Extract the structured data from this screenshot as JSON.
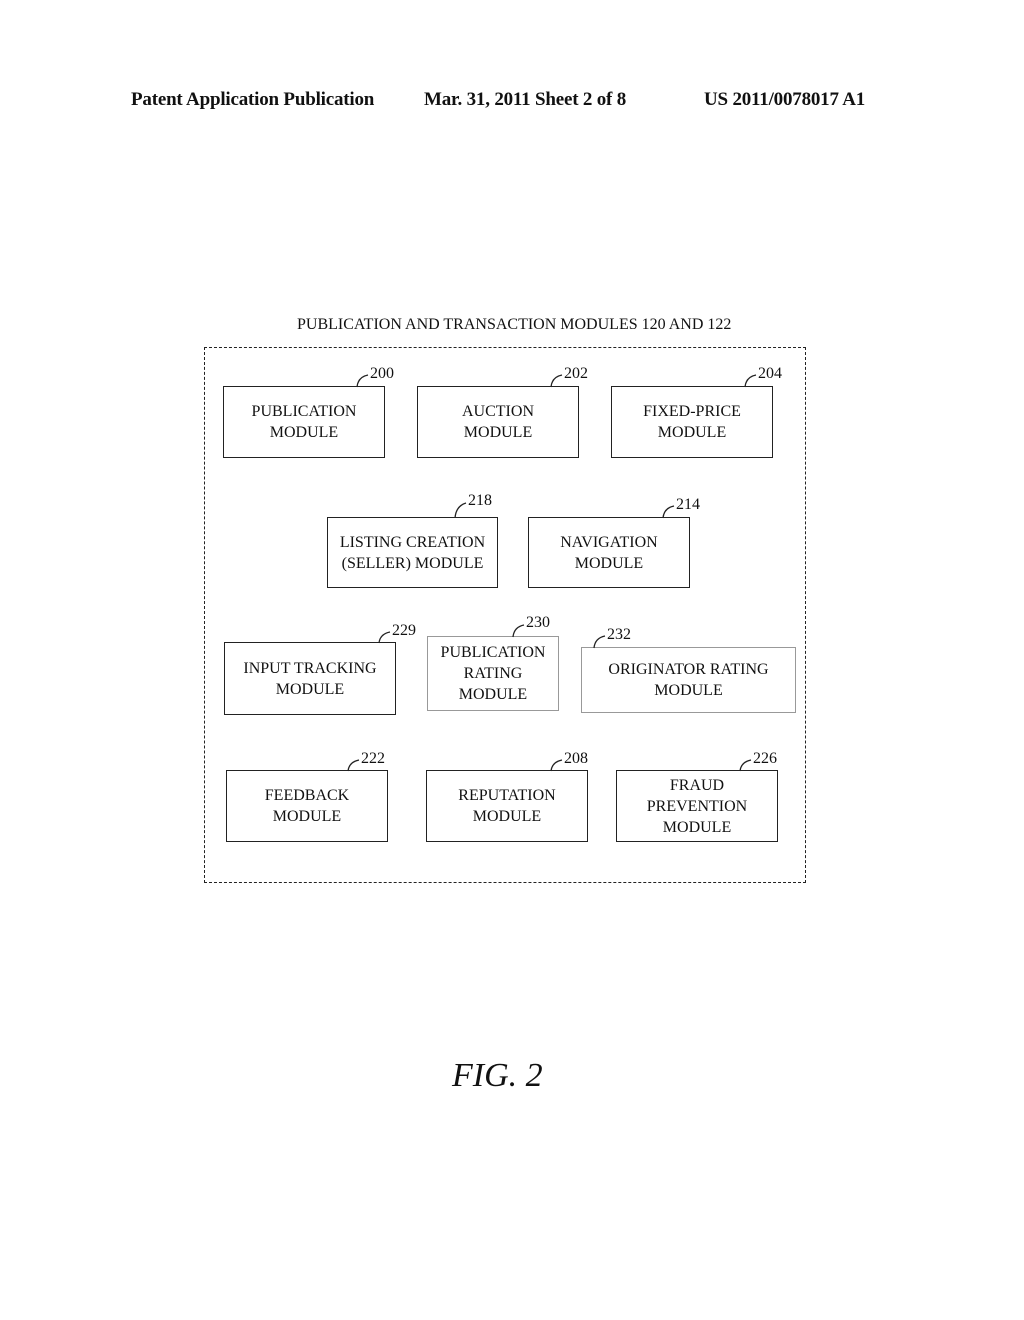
{
  "header": {
    "left": "Patent Application Publication",
    "center": "Mar. 31, 2011  Sheet 2 of 8",
    "right": "US 2011/0078017 A1"
  },
  "diagram": {
    "container_label": "PUBLICATION AND TRANSACTION MODULES 120 AND 122",
    "modules": [
      {
        "id": "200",
        "label": "PUBLICATION\nMODULE"
      },
      {
        "id": "202",
        "label": "AUCTION\nMODULE"
      },
      {
        "id": "204",
        "label": "FIXED-PRICE\nMODULE"
      },
      {
        "id": "218",
        "label": "LISTING CREATION\n(SELLER) MODULE"
      },
      {
        "id": "214",
        "label": "NAVIGATION\nMODULE"
      },
      {
        "id": "229",
        "label": "INPUT TRACKING\nMODULE"
      },
      {
        "id": "230",
        "label": "PUBLICATION\nRATING\nMODULE"
      },
      {
        "id": "232",
        "label": "ORIGINATOR RATING\nMODULE"
      },
      {
        "id": "222",
        "label": "FEEDBACK\nMODULE"
      },
      {
        "id": "208",
        "label": "REPUTATION\nMODULE"
      },
      {
        "id": "226",
        "label": "FRAUD\nPREVENTION\nMODULE"
      }
    ]
  },
  "figure_label": "FIG. 2"
}
